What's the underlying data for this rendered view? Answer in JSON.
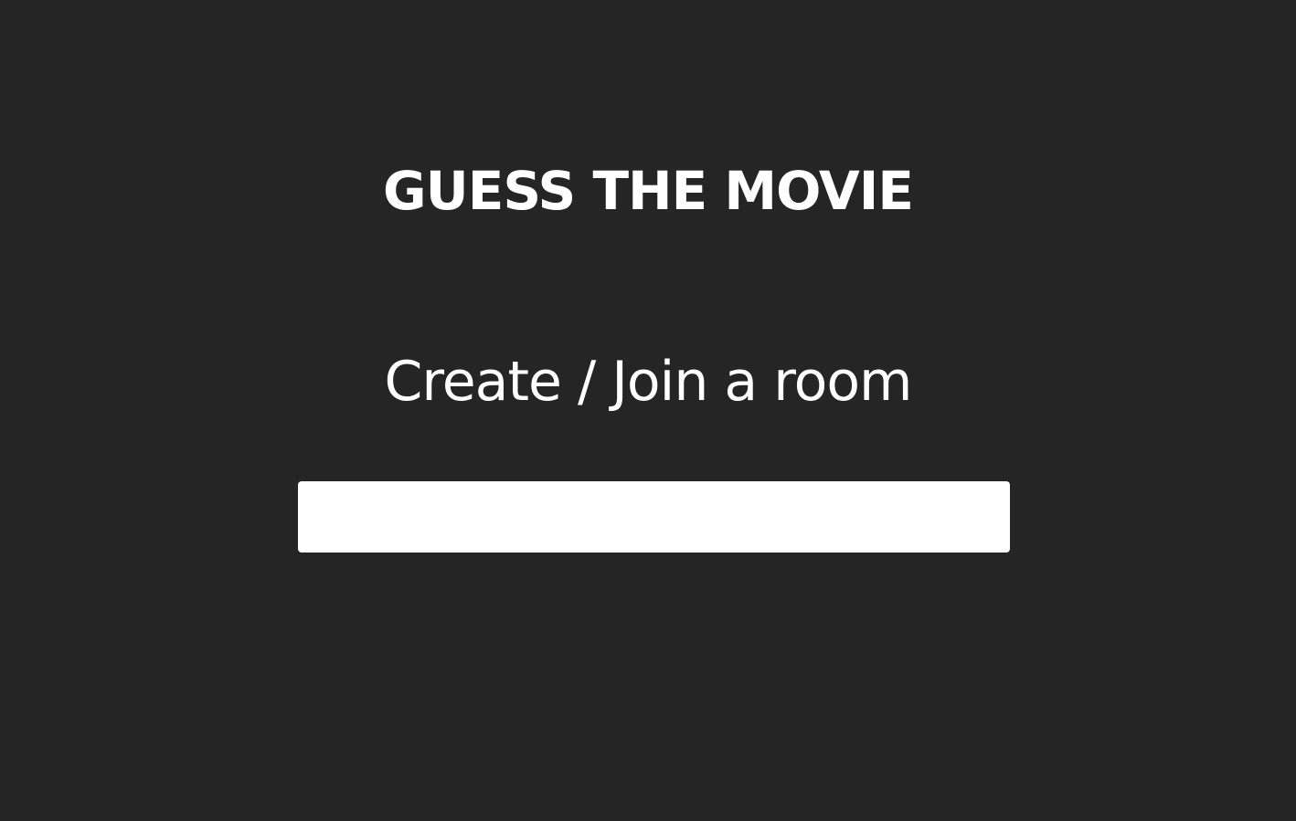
{
  "app": {
    "title": "GUESS THE MOVIE"
  },
  "room": {
    "heading": "Create / Join a room",
    "input_value": "",
    "input_placeholder": ""
  },
  "colors": {
    "background": "#252525",
    "text": "#ffffff",
    "input_background": "#ffffff"
  }
}
